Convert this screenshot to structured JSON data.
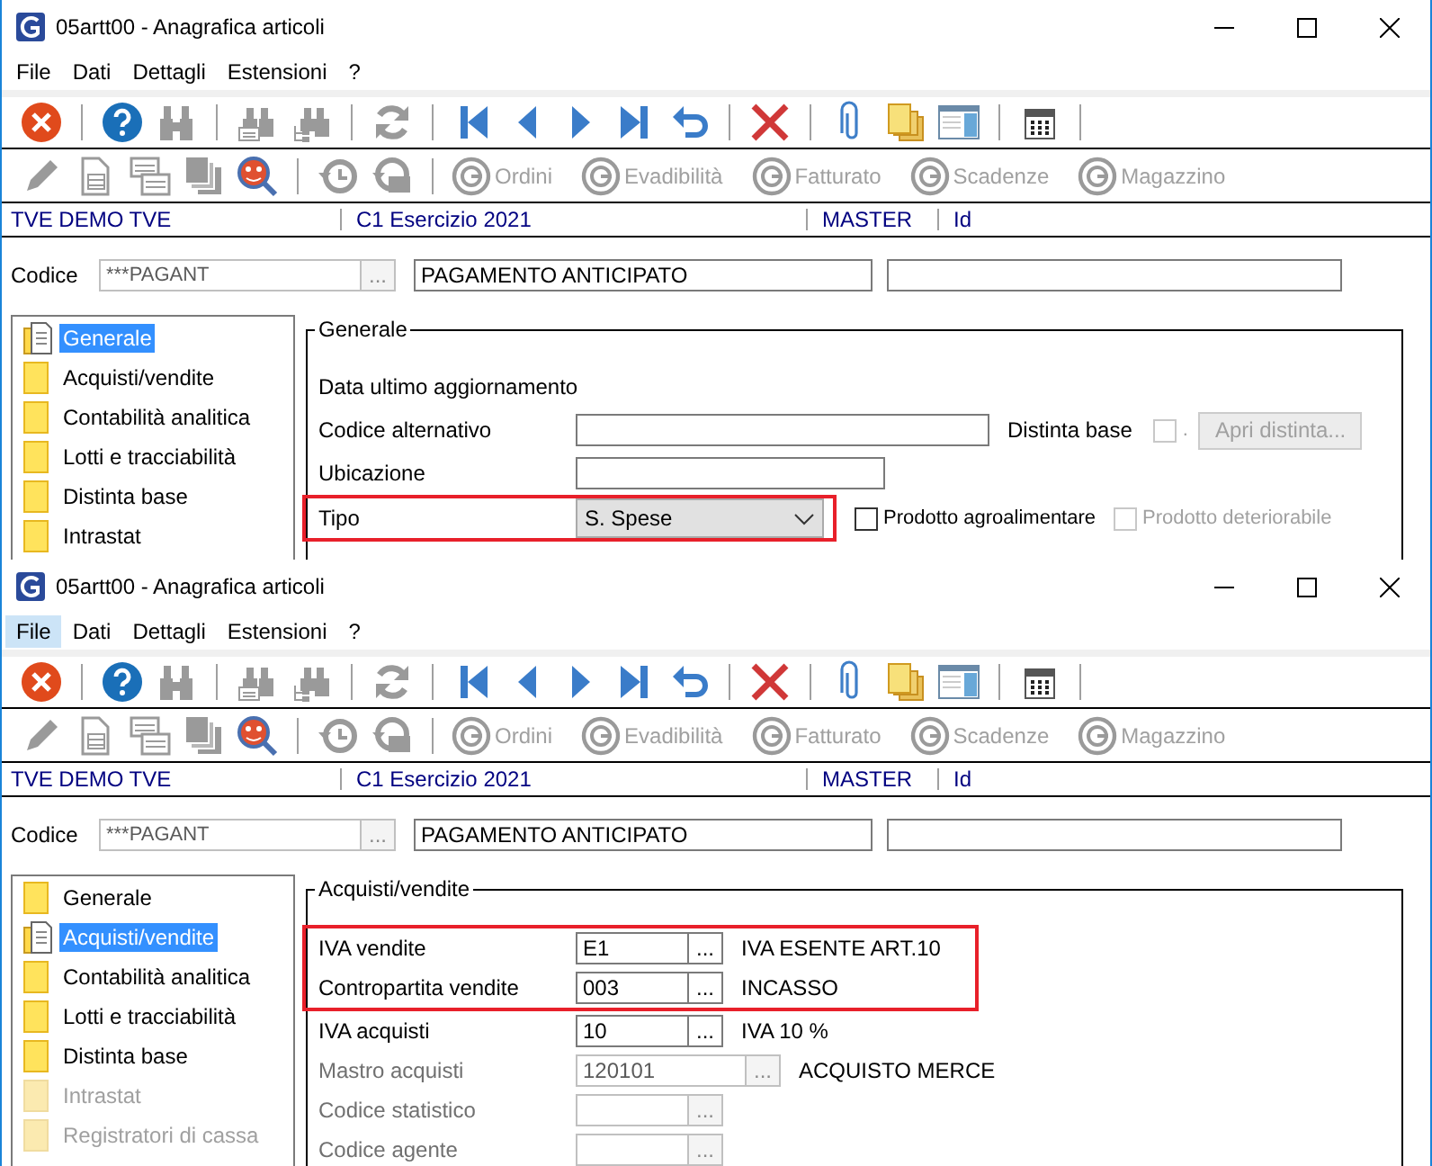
{
  "windows": [
    {
      "title": "05artt00 - Anagrafica articoli",
      "menu": [
        {
          "label": "File",
          "selected": false
        },
        {
          "label": "Dati",
          "selected": false
        },
        {
          "label": "Dettagli",
          "selected": false
        },
        {
          "label": "Estensioni",
          "selected": false
        },
        {
          "label": "?",
          "selected": false
        }
      ],
      "links": [
        {
          "label": "Ordini",
          "disabled": true
        },
        {
          "label": "Evadibilità",
          "disabled": true
        },
        {
          "label": "Fatturato",
          "disabled": true
        },
        {
          "label": "Scadenze",
          "disabled": true
        },
        {
          "label": "Magazzino",
          "disabled": true
        }
      ],
      "info": [
        "TVE DEMO TVE",
        "C1 Esercizio 2021",
        "MASTER",
        "Id"
      ],
      "codice": {
        "label": "Codice",
        "code": "***PAGANT",
        "button": "...",
        "description": "PAGAMENTO ANTICIPATO"
      },
      "sidebar": [
        {
          "label": "Generale",
          "selected": true,
          "disabled": false
        },
        {
          "label": "Acquisti/vendite",
          "selected": false,
          "disabled": false
        },
        {
          "label": "Contabilità analitica",
          "selected": false,
          "disabled": false
        },
        {
          "label": "Lotti e tracciabilità",
          "selected": false,
          "disabled": false
        },
        {
          "label": "Distinta base",
          "selected": false,
          "disabled": false
        },
        {
          "label": "Intrastat",
          "selected": false,
          "disabled": false
        }
      ],
      "group": {
        "title": "Generale",
        "rows": [
          {
            "kind": "text",
            "label": "Data ultimo aggiornamento",
            "highlighted": false,
            "disabled": false
          },
          {
            "kind": "field",
            "label": "Codice alternativo",
            "highlighted": false,
            "disabled": false,
            "side": {
              "label": "Distinta base",
              "checkbox_label": ".",
              "checked": false,
              "disabled": true,
              "button": "Apri distinta..."
            }
          },
          {
            "kind": "field-short",
            "label": "Ubicazione",
            "highlighted": false,
            "disabled": false
          },
          {
            "kind": "combo",
            "label": "Tipo",
            "value": "S. Spese",
            "highlighted": true,
            "disabled": false,
            "checks": [
              {
                "label": "Prodotto agroalimentare",
                "checked": false,
                "disabled": false
              },
              {
                "label": "Prodotto deteriorabile",
                "checked": false,
                "disabled": true
              }
            ]
          }
        ]
      }
    },
    {
      "title": "05artt00 - Anagrafica articoli",
      "menu": [
        {
          "label": "File",
          "selected": true
        },
        {
          "label": "Dati",
          "selected": false
        },
        {
          "label": "Dettagli",
          "selected": false
        },
        {
          "label": "Estensioni",
          "selected": false
        },
        {
          "label": "?",
          "selected": false
        }
      ],
      "links": [
        {
          "label": "Ordini",
          "disabled": true
        },
        {
          "label": "Evadibilità",
          "disabled": true
        },
        {
          "label": "Fatturato",
          "disabled": true
        },
        {
          "label": "Scadenze",
          "disabled": true
        },
        {
          "label": "Magazzino",
          "disabled": true
        }
      ],
      "info": [
        "TVE DEMO TVE",
        "C1 Esercizio 2021",
        "MASTER",
        "Id"
      ],
      "codice": {
        "label": "Codice",
        "code": "***PAGANT",
        "button": "...",
        "description": "PAGAMENTO ANTICIPATO"
      },
      "sidebar": [
        {
          "label": "Generale",
          "selected": false,
          "disabled": false
        },
        {
          "label": "Acquisti/vendite",
          "selected": true,
          "disabled": false
        },
        {
          "label": "Contabilità analitica",
          "selected": false,
          "disabled": false
        },
        {
          "label": "Lotti e tracciabilità",
          "selected": false,
          "disabled": false
        },
        {
          "label": "Distinta base",
          "selected": false,
          "disabled": false
        },
        {
          "label": "Intrastat",
          "selected": false,
          "disabled": true
        },
        {
          "label": "Registratori di cassa",
          "selected": false,
          "disabled": true
        }
      ],
      "group": {
        "title": "Acquisti/vendite",
        "rows": [
          {
            "kind": "lookup",
            "label": "IVA vendite",
            "value": "E1",
            "button": "...",
            "description": "IVA ESENTE ART.10",
            "highlighted": true,
            "disabled": false
          },
          {
            "kind": "lookup",
            "label": "Contropartita vendite",
            "value": "003",
            "button": "...",
            "description": "INCASSO",
            "highlighted": true,
            "disabled": false
          },
          {
            "kind": "lookup",
            "label": "IVA acquisti",
            "value": "10",
            "button": "...",
            "description": "IVA 10 %",
            "highlighted": false,
            "disabled": false
          },
          {
            "kind": "lookup-wide",
            "label": "Mastro acquisti",
            "value": "120101",
            "button": "...",
            "description": "ACQUISTO MERCE",
            "highlighted": false,
            "disabled": true
          },
          {
            "kind": "lookup",
            "label": "Codice statistico",
            "button": "...",
            "highlighted": false,
            "disabled": true
          },
          {
            "kind": "lookup",
            "label": "Codice agente",
            "button": "...",
            "highlighted": false,
            "disabled": true
          }
        ]
      }
    }
  ]
}
